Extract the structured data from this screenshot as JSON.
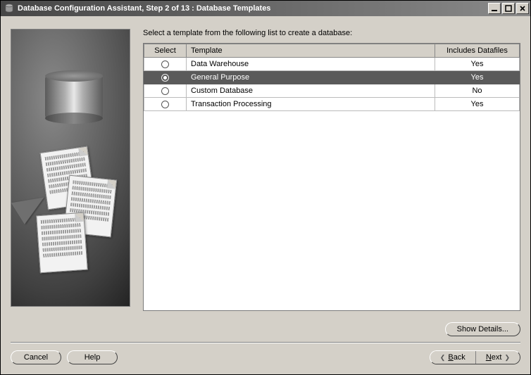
{
  "window": {
    "title": "Database Configuration Assistant, Step 2 of 13 : Database Templates"
  },
  "instruction": "Select a template from the following list to create a database:",
  "table": {
    "headers": {
      "select": "Select",
      "template": "Template",
      "includes": "Includes Datafiles"
    },
    "rows": [
      {
        "template": "Data Warehouse",
        "includes": "Yes",
        "selected": false
      },
      {
        "template": "General Purpose",
        "includes": "Yes",
        "selected": true
      },
      {
        "template": "Custom Database",
        "includes": "No",
        "selected": false
      },
      {
        "template": "Transaction Processing",
        "includes": "Yes",
        "selected": false
      }
    ]
  },
  "buttons": {
    "show_details": "Show Details...",
    "cancel": "Cancel",
    "help": "Help",
    "back": "Back",
    "next": "Next"
  }
}
